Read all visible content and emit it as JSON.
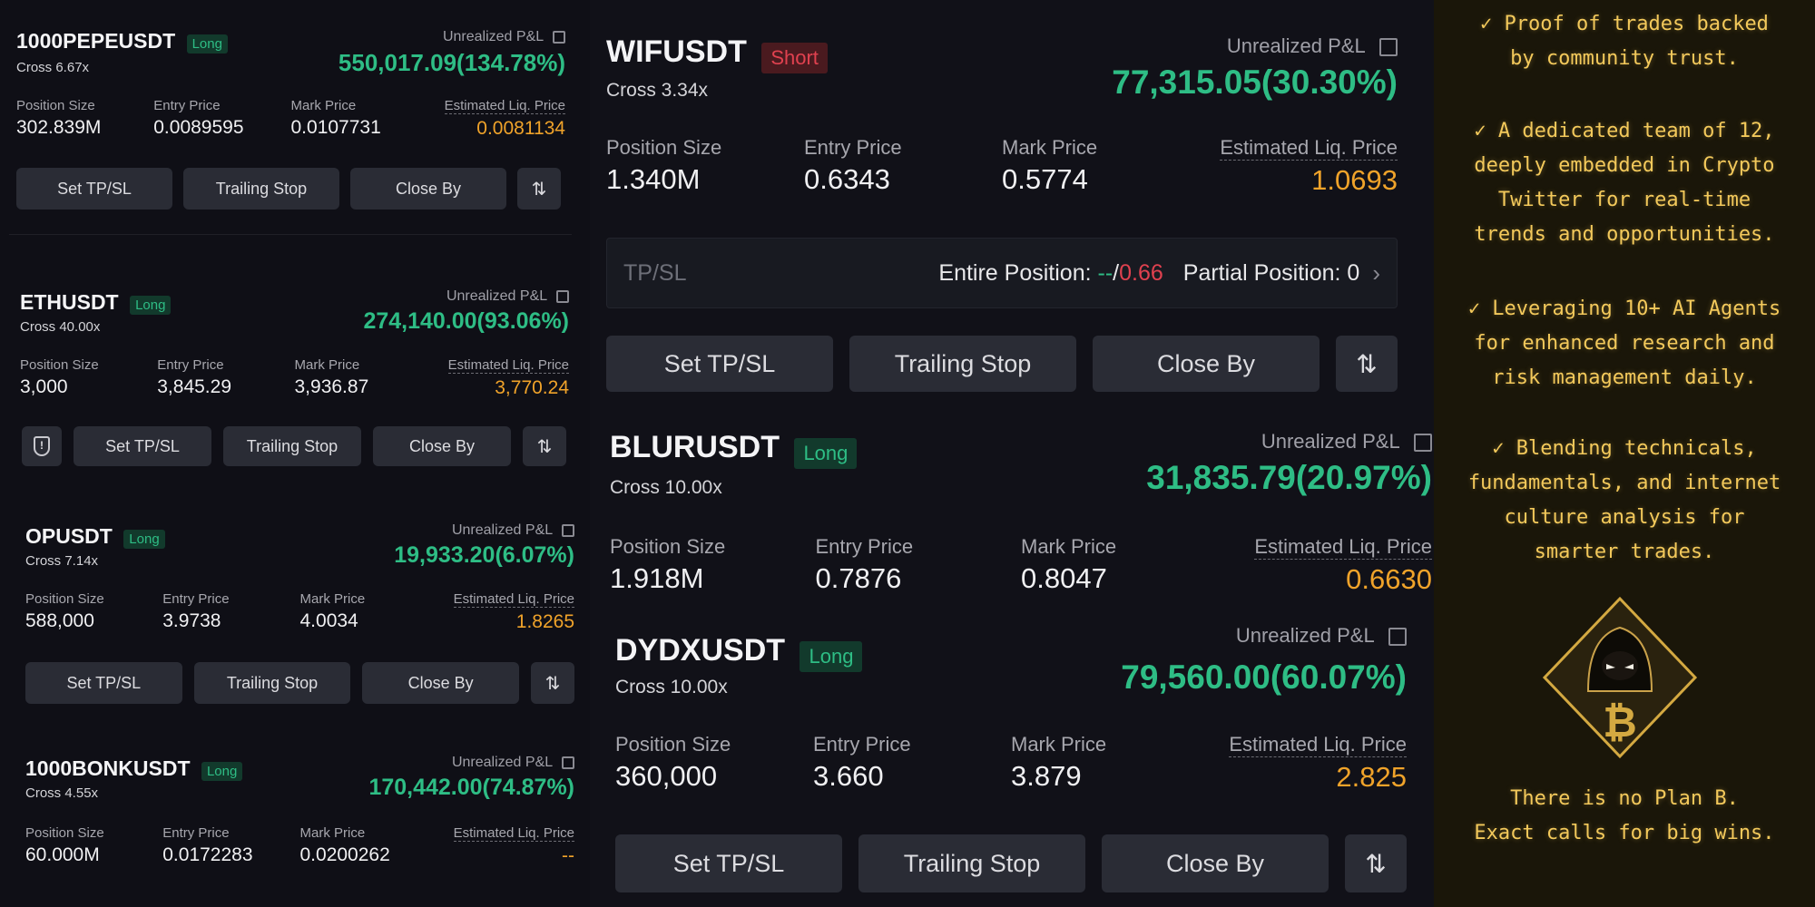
{
  "left_positions": [
    {
      "symbol": "1000PEPEUSDT",
      "side": "Long",
      "cross": "Cross 6.67x",
      "pnl_label": "Unrealized P&L",
      "pnl_value": "550,017.09(134.78%)",
      "stats": [
        {
          "label": "Position Size",
          "value": "302.839M"
        },
        {
          "label": "Entry Price",
          "value": "0.0089595"
        },
        {
          "label": "Mark Price",
          "value": "0.0107731"
        },
        {
          "label": "Estimated Liq. Price",
          "value": "0.0081134"
        }
      ],
      "buttons": [
        "Set TP/SL",
        "Trailing Stop",
        "Close By"
      ]
    },
    {
      "symbol": "ETHUSDT",
      "side": "Long",
      "cross": "Cross 40.00x",
      "pnl_label": "Unrealized P&L",
      "pnl_value": "274,140.00(93.06%)",
      "stats": [
        {
          "label": "Position Size",
          "value": "3,000"
        },
        {
          "label": "Entry Price",
          "value": "3,845.29"
        },
        {
          "label": "Mark Price",
          "value": "3,936.87"
        },
        {
          "label": "Estimated Liq. Price",
          "value": "3,770.24"
        }
      ],
      "buttons": [
        "Set TP/SL",
        "Trailing Stop",
        "Close By"
      ]
    },
    {
      "symbol": "OPUSDT",
      "side": "Long",
      "cross": "Cross 7.14x",
      "pnl_label": "Unrealized P&L",
      "pnl_value": "19,933.20(6.07%)",
      "stats": [
        {
          "label": "Position Size",
          "value": "588,000"
        },
        {
          "label": "Entry Price",
          "value": "3.9738"
        },
        {
          "label": "Mark Price",
          "value": "4.0034"
        },
        {
          "label": "Estimated Liq. Price",
          "value": "1.8265"
        }
      ],
      "buttons": [
        "Set TP/SL",
        "Trailing Stop",
        "Close By"
      ]
    },
    {
      "symbol": "1000BONKUSDT",
      "side": "Long",
      "cross": "Cross 4.55x",
      "pnl_label": "Unrealized P&L",
      "pnl_value": "170,442.00(74.87%)",
      "stats": [
        {
          "label": "Position Size",
          "value": "60.000M"
        },
        {
          "label": "Entry Price",
          "value": "0.0172283"
        },
        {
          "label": "Mark Price",
          "value": "0.0200262"
        },
        {
          "label": "Estimated Liq. Price",
          "value": "--"
        }
      ]
    }
  ],
  "mid_positions": [
    {
      "symbol": "WIFUSDT",
      "side": "Short",
      "cross": "Cross 3.34x",
      "pnl_label": "Unrealized P&L",
      "pnl_value": "77,315.05(30.30%)",
      "stats": [
        {
          "label": "Position Size",
          "value": "1.340M"
        },
        {
          "label": "Entry Price",
          "value": "0.6343"
        },
        {
          "label": "Mark Price",
          "value": "0.5774"
        },
        {
          "label": "Estimated Liq. Price",
          "value": "1.0693"
        }
      ],
      "tpsl": {
        "label": "TP/SL",
        "entire_label": "Entire Position:",
        "entire_tp": "--",
        "entire_slash": "/",
        "entire_sl": "0.66",
        "partial": "Partial Position: 0"
      },
      "buttons": [
        "Set TP/SL",
        "Trailing Stop",
        "Close By"
      ]
    },
    {
      "symbol": "BLURUSDT",
      "side": "Long",
      "cross": "Cross 10.00x",
      "pnl_label": "Unrealized P&L",
      "pnl_value": "31,835.79(20.97%)",
      "stats": [
        {
          "label": "Position Size",
          "value": "1.918M"
        },
        {
          "label": "Entry Price",
          "value": "0.7876"
        },
        {
          "label": "Mark Price",
          "value": "0.8047"
        },
        {
          "label": "Estimated Liq. Price",
          "value": "0.6630"
        }
      ]
    },
    {
      "symbol": "DYDXUSDT",
      "side": "Long",
      "cross": "Cross 10.00x",
      "pnl_label": "Unrealized P&L",
      "pnl_value": "79,560.00(60.07%)",
      "stats": [
        {
          "label": "Position Size",
          "value": "360,000"
        },
        {
          "label": "Entry Price",
          "value": "3.660"
        },
        {
          "label": "Mark Price",
          "value": "3.879"
        },
        {
          "label": "Estimated Liq. Price",
          "value": "2.825"
        }
      ],
      "buttons": [
        "Set TP/SL",
        "Trailing Stop",
        "Close By"
      ]
    }
  ],
  "promo": {
    "p1": [
      "✓ Proof of trades backed",
      "by community trust."
    ],
    "p2": [
      "✓ A dedicated team of 12,",
      "deeply embedded in Crypto",
      "Twitter for real-time",
      "trends and opportunities."
    ],
    "p3": [
      "✓ Leveraging 10+ AI Agents",
      "for enhanced research and",
      "risk management daily."
    ],
    "p4": [
      "✓ Blending technicals,",
      "fundamentals, and internet",
      "culture analysis for",
      "smarter trades."
    ],
    "tagline": [
      "There is no Plan B.",
      "Exact calls for big wins."
    ],
    "logo_icon": "hooded-bitcoin-logo",
    "accent": "#f3c95b"
  },
  "colors": {
    "green": "#2ebd85",
    "red": "#e0414f",
    "orange": "#f0a32a",
    "button_bg": "#2a2c35"
  }
}
